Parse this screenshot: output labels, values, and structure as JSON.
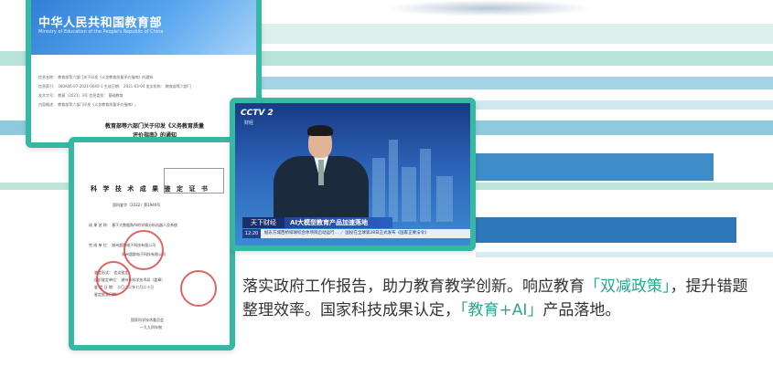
{
  "background": {
    "stripe_colors": [
      "#cfe9e3",
      "#a9dcd1",
      "#9ccfe1",
      "#4f9bd0",
      "#2d78bb",
      "#7fc6b6",
      "#d9eef2"
    ]
  },
  "moe_document": {
    "logo_title": "中华人民共和国教育部",
    "logo_subtitle": "Ministry of Education of the People's Republic of China",
    "meta_rows": [
      "信息名称： 教育部等六部门关于印发《义务教育质量评价指南》的通知",
      "信息索引： 360A06-07-2021-0040-1    生成日期： 2021-03-04          发文机构： 教育部等六部门",
      "发文字号： 教基〔2021〕3号          信息类别： 基础教育",
      "内容概述： 教育部等六部门印发《义务教育质量评价指南》。"
    ],
    "title_line1": "教育部等六部门关于印发《义务教育质量",
    "title_line2": "评价指南》的通知"
  },
  "certificate": {
    "title": "科 学 技 术 成 果 鉴 定 证 书",
    "number": "国科鉴字〔2022〕第1946号",
    "project": "成 果 名 称： 基于大数据和AI的学情分析机器人及系统",
    "org": "完 成 单 位： 湖州超群电子科技有限公司",
    "org2": "湖州超群电子科技有限公司",
    "review_lines": [
      "鉴定形式： 会议鉴定",
      "组织鉴定单位： 湖州市科学技术局（盖章）",
      "鉴 定 日 期： 二〇二二年七月二十日",
      "鉴定批准日期："
    ],
    "issuer": "国家科学技术委员会",
    "issuer_date": "一九九四年制"
  },
  "tv_news": {
    "channel_logo": "CCTV 2",
    "channel_sub": "财经",
    "program_tag": "天下财经",
    "headline": "AI大模型教育产品加速落地",
    "time": "12:20",
    "ticker": "据东方城西桥排球综合体项目启动运行…    ／  国投在全球第28日正式发布《国家正要法令》"
  },
  "caption": {
    "p1_a": "落实政府工作报告，助力教育教学创新。响应教育",
    "p1_hl": "「双减政策」",
    "p1_b": "，提升错题",
    "p2_a": "整理效率。国家科技成果认定，",
    "p2_hl": "「教育+AI」",
    "p2_b": "产品落地。"
  },
  "accent_color": "#37b8a3"
}
